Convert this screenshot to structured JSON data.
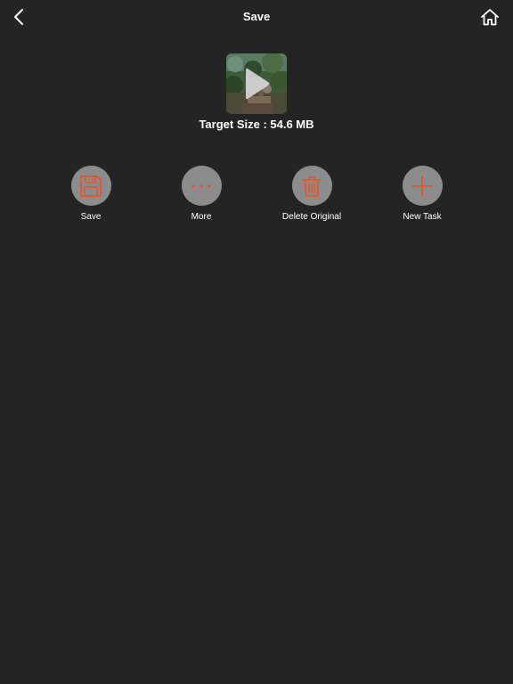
{
  "nav": {
    "title": "Save",
    "back_icon": "chevron-left-icon",
    "home_icon": "home-icon"
  },
  "preview": {
    "target_size_label": "Target Size : 54.6 MB",
    "play_icon": "play-icon"
  },
  "actions": [
    {
      "label": "Save",
      "icon": "floppy-disk-icon"
    },
    {
      "label": "More",
      "icon": "ellipsis-icon"
    },
    {
      "label": "Delete Original",
      "icon": "trash-icon"
    },
    {
      "label": "New Task",
      "icon": "plus-icon"
    }
  ],
  "colors": {
    "background": "#242424",
    "accent": "#f04e23",
    "button_circle": "#8c8c8c",
    "text": "#ffffff"
  }
}
